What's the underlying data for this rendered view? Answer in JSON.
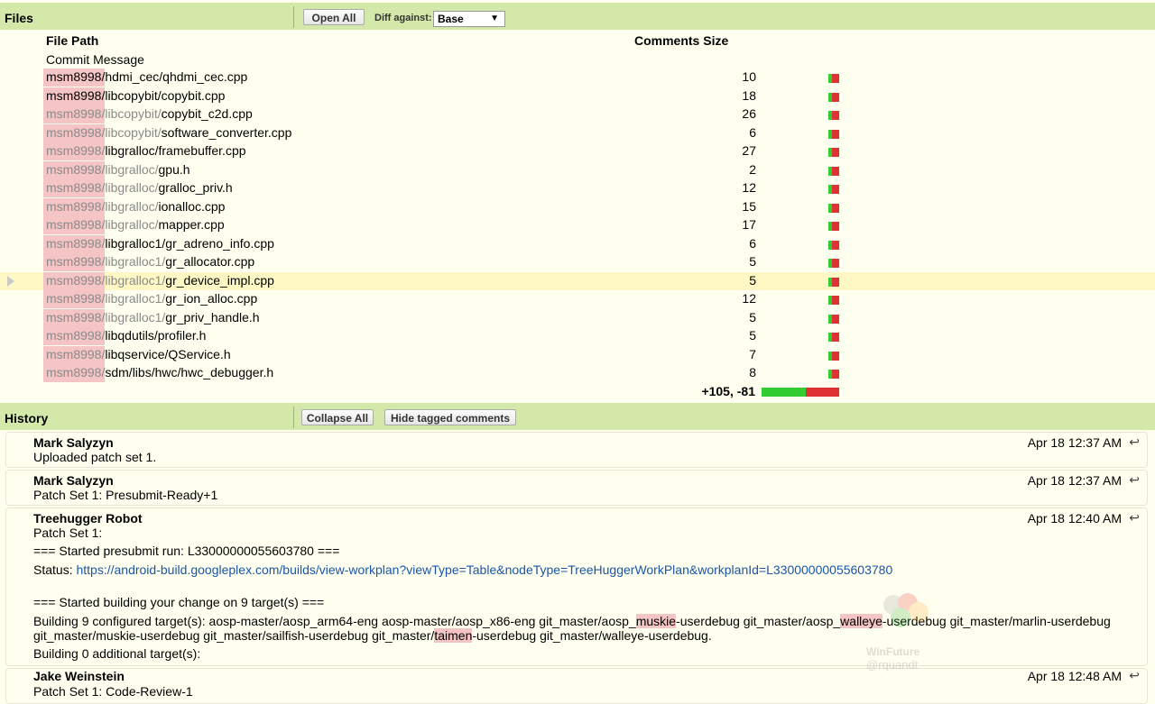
{
  "files": {
    "title": "Files",
    "open_all_label": "Open All",
    "diff_against_label": "Diff against:",
    "diff_against_value": "Base",
    "col_file_path": "File Path",
    "col_comments_size": "Comments Size",
    "commit_message": "Commit Message",
    "rows": [
      {
        "prefix": "msm8998/",
        "dim": "",
        "rest": "hdmi_cec/qhdmi_cec.cpp",
        "count": "10"
      },
      {
        "prefix": "msm8998/",
        "dim": "",
        "rest": "libcopybit/copybit.cpp",
        "count": "18"
      },
      {
        "prefix": "msm8998/",
        "dim": "libcopybit/",
        "rest": "copybit_c2d.cpp",
        "count": "26"
      },
      {
        "prefix": "msm8998/",
        "dim": "libcopybit/",
        "rest": "software_converter.cpp",
        "count": "6"
      },
      {
        "prefix": "msm8998/",
        "dim": "",
        "rest": "libgralloc/framebuffer.cpp",
        "count": "27"
      },
      {
        "prefix": "msm8998/",
        "dim": "libgralloc/",
        "rest": "gpu.h",
        "count": "2"
      },
      {
        "prefix": "msm8998/",
        "dim": "libgralloc/",
        "rest": "gralloc_priv.h",
        "count": "12"
      },
      {
        "prefix": "msm8998/",
        "dim": "libgralloc/",
        "rest": "ionalloc.cpp",
        "count": "15"
      },
      {
        "prefix": "msm8998/",
        "dim": "libgralloc/",
        "rest": "mapper.cpp",
        "count": "17"
      },
      {
        "prefix": "msm8998/",
        "dim": "",
        "rest": "libgralloc1/gr_adreno_info.cpp",
        "count": "6"
      },
      {
        "prefix": "msm8998/",
        "dim": "libgralloc1/",
        "rest": "gr_allocator.cpp",
        "count": "5"
      },
      {
        "prefix": "msm8998/",
        "dim": "libgralloc1/",
        "rest": "gr_device_impl.cpp",
        "count": "5"
      },
      {
        "prefix": "msm8998/",
        "dim": "libgralloc1/",
        "rest": "gr_ion_alloc.cpp",
        "count": "12"
      },
      {
        "prefix": "msm8998/",
        "dim": "libgralloc1/",
        "rest": "gr_priv_handle.h",
        "count": "5"
      },
      {
        "prefix": "msm8998/",
        "dim": "",
        "rest": "libqdutils/profiler.h",
        "count": "5"
      },
      {
        "prefix": "msm8998/",
        "dim": "",
        "rest": "libqservice/QService.h",
        "count": "7"
      },
      {
        "prefix": "msm8998/",
        "dim": "",
        "rest": "sdm/libs/hwc/hwc_debugger.h",
        "count": "8"
      }
    ],
    "selected_row_index": 11,
    "totals": "+105, -81"
  },
  "history": {
    "title": "History",
    "collapse_all_label": "Collapse All",
    "hide_tagged_label": "Hide tagged comments",
    "reply_icon": "↩",
    "messages": [
      {
        "author": "Mark Salyzyn",
        "date": "Apr 18 12:37 AM",
        "line1": "Uploaded patch set 1."
      },
      {
        "author": "Mark Salyzyn",
        "date": "Apr 18 12:37 AM",
        "line1": "Patch Set 1: Presubmit-Ready+1"
      },
      {
        "author": "Treehugger Robot",
        "date": "Apr 18 12:40 AM",
        "line1": "Patch Set 1:",
        "line2": "=== Started presubmit run: L33000000055603780 ===",
        "status_label": "Status:",
        "status_link": "https://android-build.googleplex.com/builds/view-workplan?viewType=Table&nodeType=TreeHuggerWorkPlan&workplanId=L33000000055603780",
        "line3": "=== Started building your change on 9 target(s) ===",
        "b1": "Building 9 configured target(s): aosp-master/aosp_arm64-eng aosp-master/aosp_x86-eng git_master/aosp_",
        "b1_mark1": "muskie",
        "b2": "-userdebug git_master/aosp_",
        "b2_mark2": "walleye",
        "b3": "-userdebug git_master/marlin-userdebug",
        "b4": "git_master/muskie-userdebug git_master/sailfish-userdebug git_master/",
        "b4_mark": "taimen",
        "b5": "-userdebug git_master/walleye-userdebug.",
        "line4": "Building 0 additional target(s):"
      },
      {
        "author": "Jake Weinstein",
        "date": "Apr 18 12:48 AM",
        "line1": "Patch Set 1: Code-Review-1"
      }
    ]
  },
  "watermark": {
    "line1": "WinFuture",
    "line2": "@rquandt"
  },
  "colors": {
    "section_bar": "#d4e9a9",
    "page_bg": "#fffff0",
    "highlight": "#f5c5c5",
    "added": "#33cc33",
    "removed": "#dd3333",
    "selected_row": "#fff8c5"
  }
}
